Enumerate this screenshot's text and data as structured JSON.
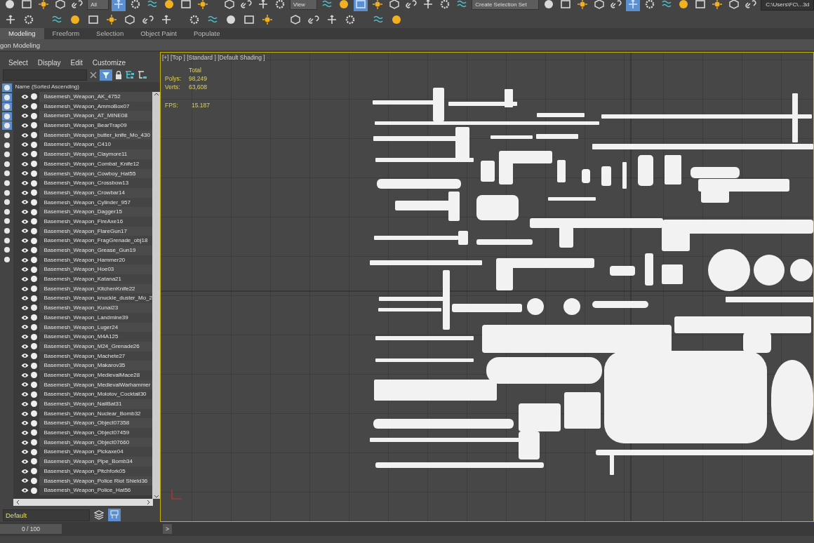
{
  "toolbar": {
    "dropdowns": [
      "All",
      "View",
      "Create Selection Set"
    ],
    "path": "C:\\Users\\FC\\...3d"
  },
  "ribbon": {
    "tabs": [
      {
        "label": "Modeling",
        "selected": true
      },
      {
        "label": "Freeform",
        "selected": false
      },
      {
        "label": "Selection",
        "selected": false
      },
      {
        "label": "Object Paint",
        "selected": false
      },
      {
        "label": "Populate",
        "selected": false
      }
    ],
    "panel_title": "gon Modeling"
  },
  "scene_explorer": {
    "menu": [
      "Select",
      "Display",
      "Edit",
      "Customize"
    ],
    "filter_buttons": [
      {
        "on": true
      },
      {
        "on": true
      },
      {
        "on": true
      },
      {
        "on": true
      },
      {
        "on": true
      },
      {
        "on": false
      },
      {
        "on": false
      },
      {
        "on": false
      },
      {
        "on": false
      },
      {
        "on": false
      },
      {
        "on": false
      },
      {
        "on": false
      },
      {
        "on": false
      },
      {
        "on": false
      },
      {
        "on": false
      },
      {
        "on": false
      },
      {
        "on": false
      },
      {
        "on": false
      },
      {
        "on": false
      }
    ],
    "column_header": "Name (Sorted Ascending)",
    "objects": [
      "Basemesh_Weapon_AK_4752",
      "Basemesh_Weapon_AmmoBox07",
      "Basemesh_Weapon_AT_MINE08",
      "Basemesh_Weapon_BearTrap09",
      "Basemesh_Weapon_butter_knife_Mo_430",
      "Basemesh_Weapon_C410",
      "Basemesh_Weapon_Claymore11",
      "Basemesh_Weapon_Combat_Knife12",
      "Basemesh_Weapon_Cowboy_Hat55",
      "Basemesh_Weapon_Crossbow13",
      "Basemesh_Weapon_Crowbar14",
      "Basemesh_Weapon_Cylinder_957",
      "Basemesh_Weapon_Dagger15",
      "Basemesh_Weapon_FireAxe16",
      "Basemesh_Weapon_FlareGun17",
      "Basemesh_Weapon_FragGrenade_obj18",
      "Basemesh_Weapon_Grease_Gun19",
      "Basemesh_Weapon_Hammer20",
      "Basemesh_Weapon_Hoe03",
      "Basemesh_Weapon_Katana21",
      "Basemesh_Weapon_KitchenKnife22",
      "Basemesh_Weapon_knuckle_duster_Mo_2",
      "Basemesh_Weapon_Kunai23",
      "Basemesh_Weapon_Landmine39",
      "Basemesh_Weapon_Luger24",
      "Basemesh_Weapon_M4A125",
      "Basemesh_Weapon_M24_Grenade26",
      "Basemesh_Weapon_Machete27",
      "Basemesh_Weapon_Makarov35",
      "Basemesh_Weapon_MedievalMace28",
      "Basemesh_Weapon_MedievalWarhammer",
      "Basemesh_Weapon_Molotov_Cocktail30",
      "Basemesh_Weapon_NailBat31",
      "Basemesh_Weapon_Nuclear_Bomb32",
      "Basemesh_Weapon_Object07358",
      "Basemesh_Weapon_Object07459",
      "Basemesh_Weapon_Object07660",
      "Basemesh_Weapon_Pickaxe04",
      "Basemesh_Weapon_Pipe_Bomb34",
      "Basemesh_Weapon_Pitchfork05",
      "Basemesh_Weapon_Police Riot Shield36",
      "Basemesh_Weapon_Police_Hat56"
    ],
    "layer": "Default"
  },
  "viewport": {
    "label": "[+] [Top ] [Standard ] [Default Shading ]",
    "stats_header": "Total",
    "stats": [
      {
        "label": "Polys:",
        "value": "98,249"
      },
      {
        "label": "Verts:",
        "value": "63,608"
      }
    ],
    "fps_label": "FPS:",
    "fps": "15.187"
  },
  "timeline": {
    "frame": "0 / 100",
    "level": 0,
    "next": ">"
  }
}
